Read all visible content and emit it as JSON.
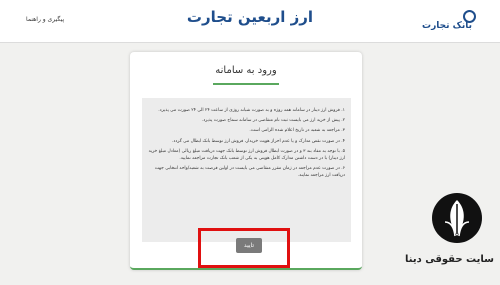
{
  "header": {
    "title": "ارز اربعین تجارت",
    "help_link": "پیگیری و راهنما",
    "bank_logo_text": "بانک تجارت"
  },
  "login_card": {
    "title": "ورود به سامانه",
    "rules": [
      "۱. فروش ارز دینار در سامانه همه روزه و به صورت شبانه روزی از ساعت ۲۴ الی ۲۴ صورت می پذیرد.",
      "۲. پیش از خرید ارز می بایست ثبت نام متقاضی در سامانه سماح صورت پذیرد.",
      "۳. مراجعه به شعبه در تاریخ اعلام شده الزامی است.",
      "۴. در صورت نقص مدارک و یا عدم احراز هویت خریدار، فروش ارز توسط بانک ابطال می گردد.",
      "۵. با توجه به مفاد بند ۳ و در صورت ابطال فروش ارز توسط بانک جهت دریافت مبلغ ریالی (معادل مبلغ خرید ارز دینار) با در دست داشتن مدارک کامل هویتی به یکی از شعب بانک تجارت مراجعه نمایید.",
      "۶. در صورت عدم مراجعه در زمان مقرر متقاضی می بایست در اولین فرصت به شعبه/واحد انتخابی جهت دریافت ارز مراجعه نمایند."
    ],
    "confirm_label": "تایید"
  },
  "watermark": {
    "caption": "سایت حقوقی دینا"
  },
  "colors": {
    "accent_green": "#5aa85e",
    "brand_blue": "#1f4e8c",
    "highlight_red": "#e01010",
    "button_gray": "#7a7a7a"
  }
}
